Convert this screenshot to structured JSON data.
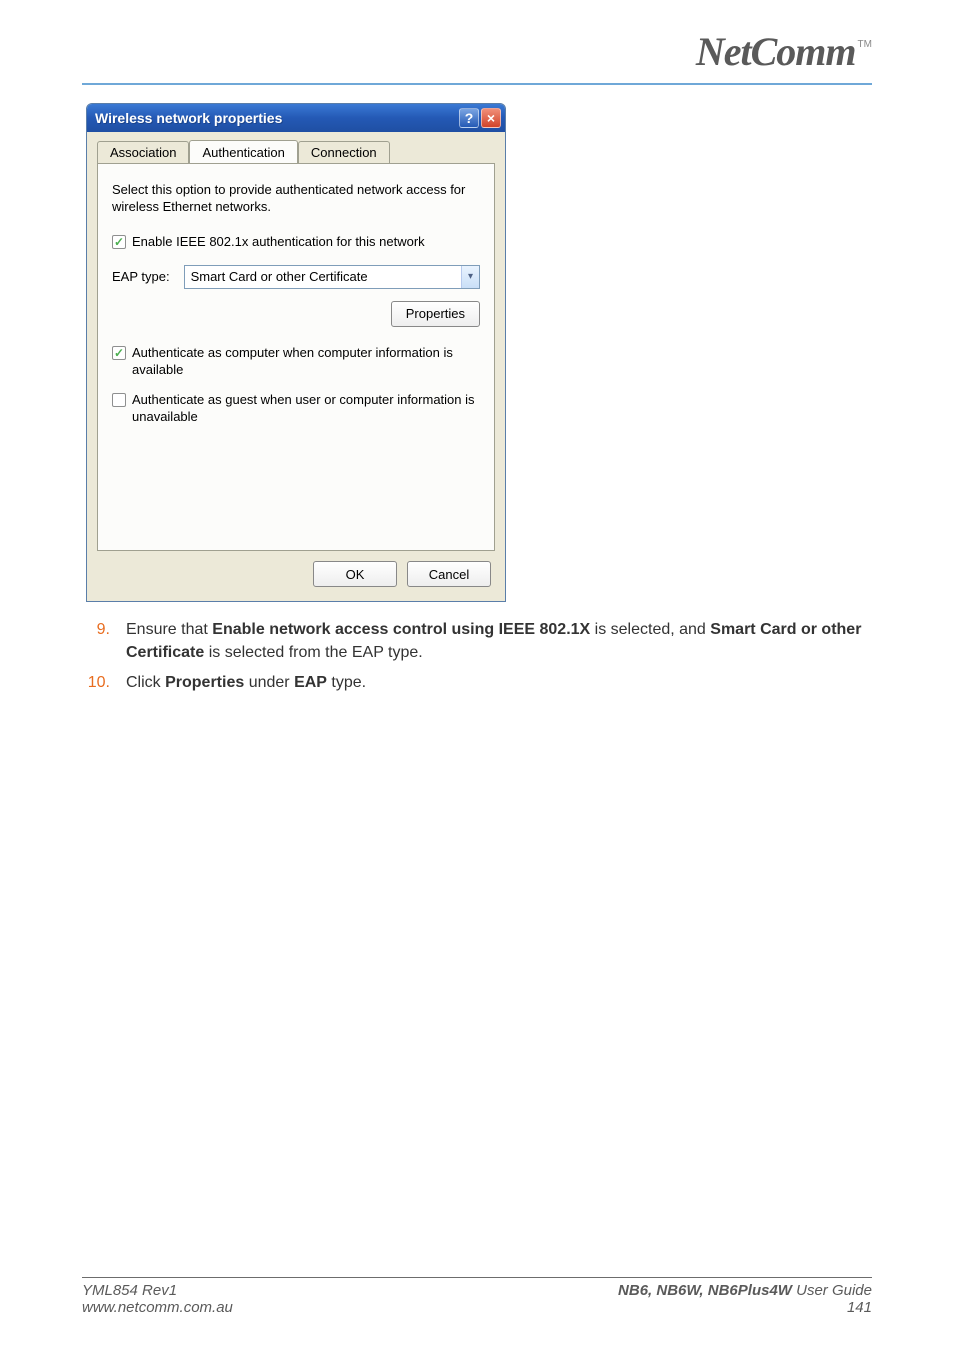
{
  "header": {
    "logo_text": "NetComm",
    "logo_tm": "TM"
  },
  "dialog": {
    "title": "Wireless network properties",
    "tabs": [
      "Association",
      "Authentication",
      "Connection"
    ],
    "active_tab_index": 1,
    "description": "Select this option to provide authenticated network access for wireless Ethernet networks.",
    "enable_8021x_label": "Enable IEEE 802.1x authentication for this network",
    "eap_type_label": "EAP type:",
    "eap_type_value": "Smart Card or other Certificate",
    "properties_button": "Properties",
    "auth_as_computer_label": "Authenticate as computer when computer information is available",
    "auth_as_guest_label": "Authenticate as guest when user or computer information is unavailable",
    "ok_button": "OK",
    "cancel_button": "Cancel"
  },
  "steps": {
    "item9_num": "9.",
    "item9_prefix": "Ensure that ",
    "item9_bold1": "Enable network access control using IEEE 802.1X",
    "item9_mid": " is selected, and ",
    "item9_bold2": "Smart Card or other Certificate",
    "item9_suffix": " is selected from the EAP type.",
    "item10_num": "10.",
    "item10_prefix": "Click ",
    "item10_bold1": "Properties",
    "item10_mid": " under ",
    "item10_bold2": "EAP",
    "item10_suffix": " type."
  },
  "footer": {
    "left_line1": "YML854 Rev1",
    "left_line2": "www.netcomm.com.au",
    "right_line1_bold": "NB6, NB6W, NB6Plus4W",
    "right_line1_rest": " User Guide",
    "right_line2": "141"
  }
}
